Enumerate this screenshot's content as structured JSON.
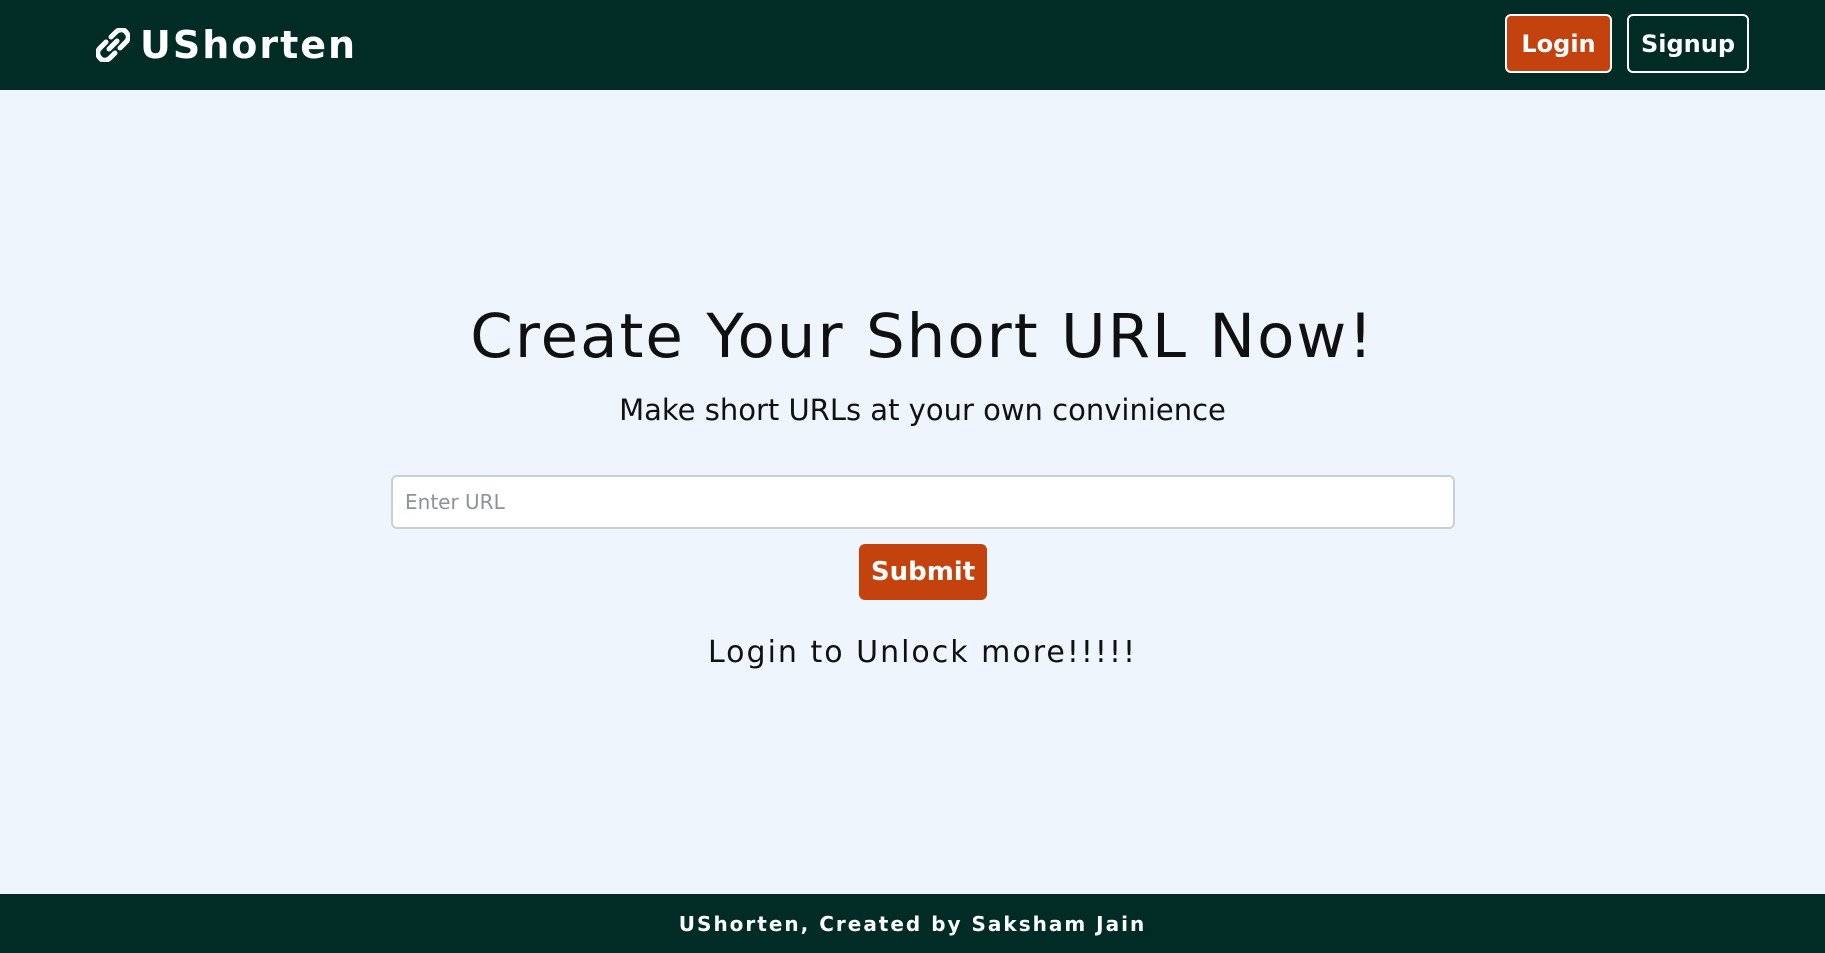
{
  "header": {
    "brand_text": "UShorten",
    "brand_icon": "link-icon",
    "login_label": "Login",
    "signup_label": "Signup"
  },
  "main": {
    "title": "Create Your Short URL Now!",
    "subtitle": "Make short URLs at your own convinience",
    "url_input": {
      "value": "",
      "placeholder": "Enter URL"
    },
    "submit_label": "Submit",
    "unlock_text": "Login to Unlock more!!!!!"
  },
  "footer": {
    "text": "UShorten, Created by Saksham Jain"
  },
  "colors": {
    "header_bg": "#012b25",
    "page_bg": "#eef5fd",
    "accent": "#c3420d",
    "text": "#111111"
  }
}
